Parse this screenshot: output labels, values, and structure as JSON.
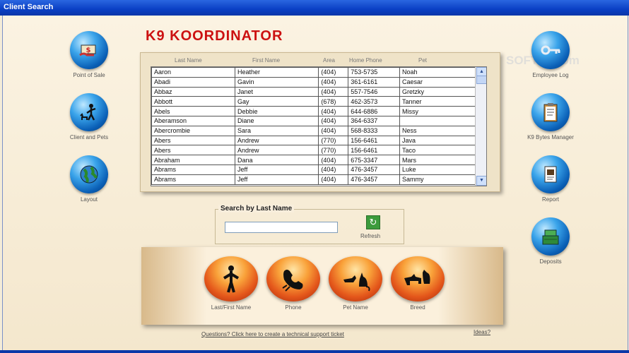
{
  "window": {
    "title": "Client Search"
  },
  "brand": "K9 KOORDINATOR",
  "watermark": "SOFT32.com",
  "left_nav": [
    {
      "label": "Point of Sale",
      "icon": "money-hand-icon"
    },
    {
      "label": "Client and Pets",
      "icon": "person-dog-icon"
    },
    {
      "label": "Layout",
      "icon": "globe-icon"
    }
  ],
  "right_nav": [
    {
      "label": "Employee Log",
      "icon": "key-icon"
    },
    {
      "label": "K9 Bytes Manager",
      "icon": "clipboard-icon"
    },
    {
      "label": "Report",
      "icon": "report-icon"
    },
    {
      "label": "Deposits",
      "icon": "cash-register-icon"
    }
  ],
  "grid": {
    "columns": [
      "Last Name",
      "First Name",
      "Area",
      "Home Phone",
      "Pet"
    ],
    "rows": [
      [
        "Aaron",
        "Heather",
        "(404)",
        "753-5735",
        "Noah"
      ],
      [
        "Abadi",
        "Gavin",
        "(404)",
        "361-6161",
        "Caesar"
      ],
      [
        "Abbaz",
        "Janet",
        "(404)",
        "557-7546",
        "Gretzky"
      ],
      [
        "Abbott",
        "Gay",
        "(678)",
        "462-3573",
        "Tanner"
      ],
      [
        "Abels",
        "Debbie",
        "(404)",
        "644-6886",
        "Missy"
      ],
      [
        "Aberamson",
        "Diane",
        "(404)",
        "364-6337",
        ""
      ],
      [
        "Abercrombie",
        "Sara",
        "(404)",
        "568-8333",
        "Ness"
      ],
      [
        "Abers",
        "Andrew",
        "(770)",
        "156-6461",
        "Java"
      ],
      [
        "Abers",
        "Andrew",
        "(770)",
        "156-6461",
        "Taco"
      ],
      [
        "Abraham",
        "Dana",
        "(404)",
        "675-3347",
        "Mars"
      ],
      [
        "Abrams",
        "Jeff",
        "(404)",
        "476-3457",
        "Luke"
      ],
      [
        "Abrams",
        "Jeff",
        "(404)",
        "476-3457",
        "Sammy"
      ]
    ]
  },
  "search": {
    "title": "Search by Last Name",
    "value": "",
    "refresh_label": "Refresh"
  },
  "search_buttons": [
    {
      "label": "Last/First Name",
      "icon": "person-silhouette-icon"
    },
    {
      "label": "Phone",
      "icon": "phone-icon"
    },
    {
      "label": "Pet Name",
      "icon": "dog-cat-icon"
    },
    {
      "label": "Breed",
      "icon": "dogs-icon"
    }
  ],
  "footer": {
    "support_link": "Questions? Click here to create a technical support ticket",
    "ideas_link": "Ideas?"
  }
}
